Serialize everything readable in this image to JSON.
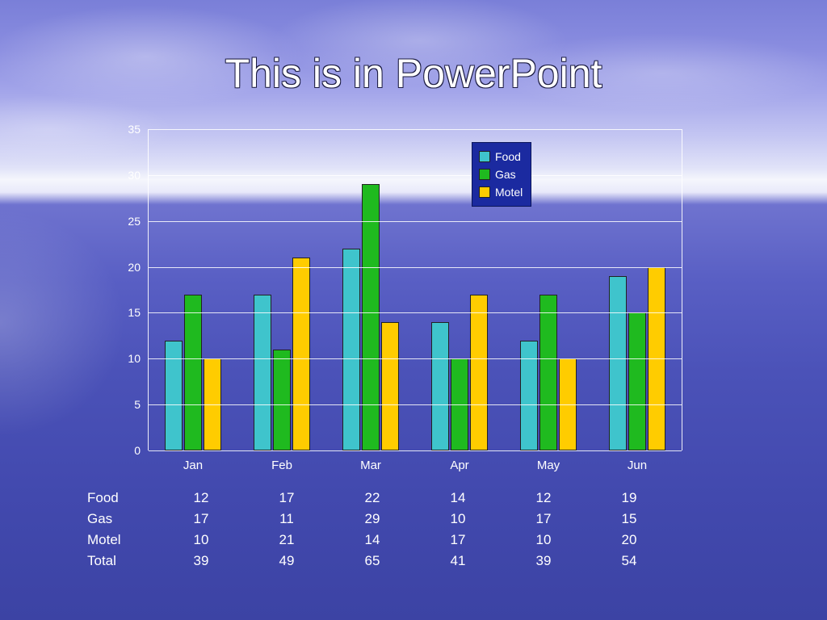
{
  "title": "This is in PowerPoint",
  "chart_data": {
    "type": "bar",
    "categories": [
      "Jan",
      "Feb",
      "Mar",
      "Apr",
      "May",
      "Jun"
    ],
    "series": [
      {
        "name": "Food",
        "values": [
          12,
          17,
          22,
          14,
          12,
          19
        ]
      },
      {
        "name": "Gas",
        "values": [
          17,
          11,
          29,
          10,
          17,
          15
        ]
      },
      {
        "name": "Motel",
        "values": [
          10,
          21,
          14,
          17,
          10,
          20
        ]
      }
    ],
    "ylim": [
      0,
      35
    ],
    "yticks": [
      0,
      5,
      10,
      15,
      20,
      25,
      30,
      35
    ],
    "legend_position": "top-right"
  },
  "table_rows": [
    "Food",
    "Gas",
    "Motel",
    "Total"
  ],
  "totals": [
    39,
    49,
    65,
    41,
    39,
    54
  ]
}
